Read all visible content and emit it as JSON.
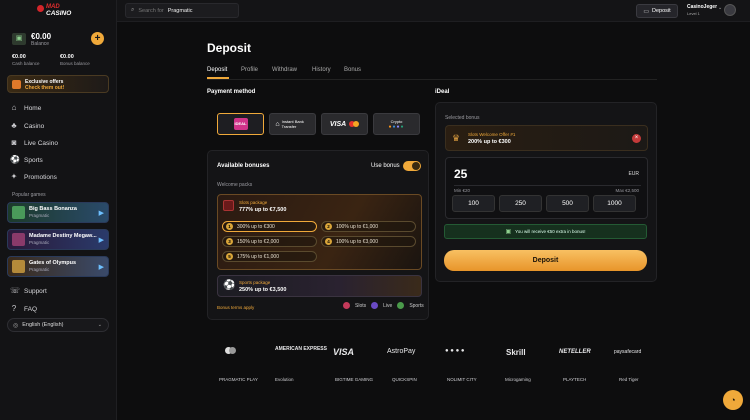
{
  "brand": {
    "logo_line1": "MAD",
    "logo_line2": "CASINO"
  },
  "wallet": {
    "balance": "€0.00",
    "balance_label": "Balance",
    "cash": "€0.00",
    "cash_label": "Cash balance",
    "bonus": "€0.00",
    "bonus_label": "Bonus balance"
  },
  "promo": {
    "title": "Exclusive offers",
    "link": "Check them out!"
  },
  "nav": [
    {
      "label": "Home",
      "icon": "home-icon"
    },
    {
      "label": "Casino",
      "icon": "casino-icon"
    },
    {
      "label": "Live Casino",
      "icon": "live-casino-icon"
    },
    {
      "label": "Sports",
      "icon": "sports-icon"
    },
    {
      "label": "Promotions",
      "icon": "promotions-icon"
    }
  ],
  "popular": {
    "heading": "Popular games",
    "games": [
      {
        "title": "Big Bass Bonanza",
        "provider": "Pragmatic"
      },
      {
        "title": "Madame Destiny Megaw...",
        "provider": "Pragmatic"
      },
      {
        "title": "Gates of Olympus",
        "provider": "Pragmatic"
      }
    ]
  },
  "footer_nav": [
    {
      "label": "Support",
      "icon": "support-icon"
    },
    {
      "label": "FAQ",
      "icon": "faq-icon"
    }
  ],
  "language": {
    "value": "English (English)"
  },
  "search": {
    "placeholder": "Search for",
    "term": "Pragmatic"
  },
  "header": {
    "deposit_label": "Deposit",
    "username": "CasinoJeger",
    "level": "Level 1"
  },
  "page": {
    "title": "Deposit",
    "tabs": [
      "Deposit",
      "Profile",
      "Withdraw",
      "History",
      "Bonus"
    ],
    "payment_method_heading": "Payment method",
    "methods": [
      "iDEAL",
      "Instant Bank Transfer",
      "VISA",
      "Crypto"
    ],
    "ideal_heading": "iDeal"
  },
  "bonuses": {
    "heading": "Available bonuses",
    "use_bonus_label": "Use bonus",
    "welcome_label": "Welcome packs",
    "slots": {
      "type": "Slots package",
      "amount": "777% up to €7,500"
    },
    "options": [
      {
        "n": "1",
        "text": "300% up to €300"
      },
      {
        "n": "2",
        "text": "100% up to €1,000"
      },
      {
        "n": "3",
        "text": "150% up to €2,000"
      },
      {
        "n": "4",
        "text": "100% up to €3,000"
      },
      {
        "n": "5",
        "text": "175% up to €1,000"
      }
    ],
    "sports": {
      "type": "Sports package",
      "amount": "250% up to €3,500"
    },
    "terms": "Bonus terms apply",
    "legend": [
      "Slots",
      "Live",
      "Sports"
    ]
  },
  "ideal": {
    "selected_label": "Selected bonus",
    "selected_name": "Slots Welcome Offer #1",
    "selected_amount": "200% up to €300",
    "amount": "25",
    "currency": "EUR",
    "min": "Min €20",
    "max": "Max €2,500",
    "quick": [
      "100",
      "250",
      "500",
      "1000"
    ],
    "extra_note": "You will receive €50 extra in bonus!",
    "deposit_button": "Deposit"
  },
  "payment_logos_row1": [
    "mastercard",
    "AMERICAN EXPRESS",
    "VISA",
    "AstroPay",
    "● ● ● ●",
    "Skrill",
    "NETELLER",
    "paysafecard"
  ],
  "payment_logos_row2": [
    "PRAGMATIC PLAY",
    "Evolution",
    "BIGTIME GAMING",
    "QUICKSPIN",
    "NOLIMIT CITY",
    "Microgaming",
    "PLAYTECH",
    "Red Tiger"
  ],
  "colors": {
    "accent": "#f0a93a",
    "bg": "#0d0d0e",
    "panel": "#151517"
  }
}
